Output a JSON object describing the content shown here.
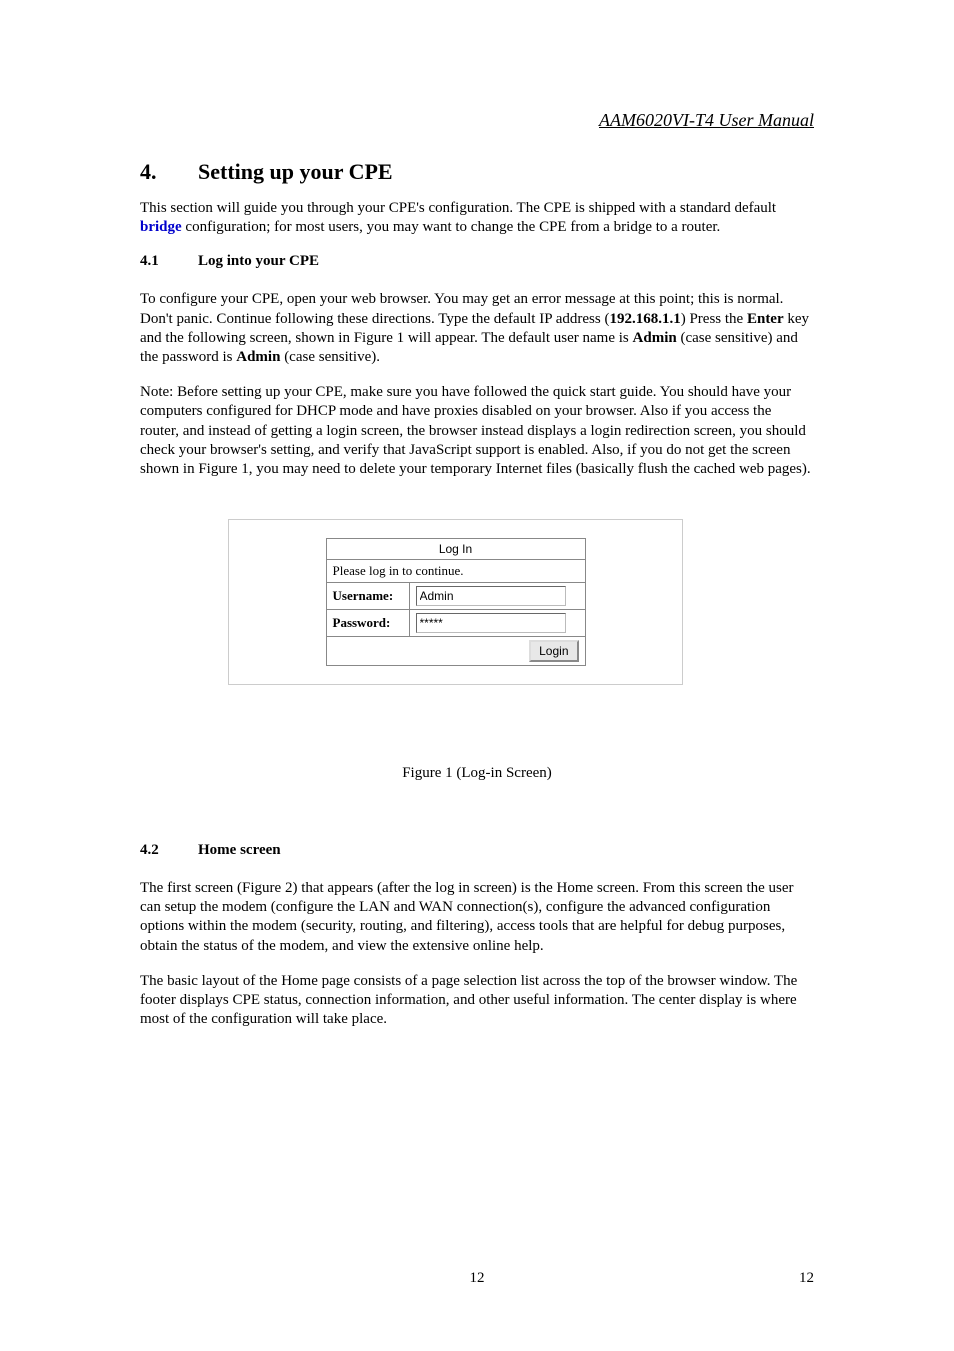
{
  "header": {
    "doc_title": "AAM6020VI-T4 User Manual"
  },
  "section": {
    "num": "4.",
    "title": "Setting up your CPE",
    "intro_1": "This section will guide you through your CPE's configuration.   The CPE is shipped with a standard default ",
    "intro_blue": "bridge",
    "intro_2": " configuration; for most users, you may want to change the CPE from a bridge to a router."
  },
  "sub41": {
    "num": "4.1",
    "title": "Log into your CPE",
    "p1_a": "To configure your CPE, open your web browser.  You may get an error message at this point; this is normal.  Don't panic.  Continue following these directions. Type the default IP address (",
    "p1_ip": "192.168.1.1",
    "p1_b": ") Press the ",
    "p1_enter": "Enter",
    "p1_c": " key and the following screen, shown in Figure 1 will appear. The default user name is ",
    "p1_admin1": "Admin",
    "p1_d": " (case sensitive) and the password is ",
    "p1_admin2": "Admin",
    "p1_e": "  (case sensitive).",
    "p2": "Note: Before setting up your CPE, make sure you have followed the quick start guide.  You should have your computers configured for DHCP mode and have proxies disabled on your browser.  Also if you access the router, and instead of getting a login screen, the browser instead displays a login redirection screen, you should check your browser's setting, and verify that JavaScript support is enabled.  Also, if you do not get the screen shown in Figure 1, you may need to delete your temporary Internet files (basically flush the cached web pages)."
  },
  "login": {
    "box_title": "Log In",
    "message": "Please log in to continue.",
    "user_label": "Username:",
    "user_value": "Admin",
    "pass_label": "Password:",
    "pass_value": "*****",
    "button": "Login"
  },
  "figure1_caption": "Figure 1 (Log-in Screen)",
  "sub42": {
    "num": "4.2",
    "title": "Home screen",
    "p1": "The first screen (Figure 2) that appears (after the log in screen) is the Home screen.  From this screen the user can setup the modem (configure the LAN and WAN connection(s), configure the advanced configuration options within the modem (security, routing, and filtering), access tools that are helpful for debug purposes, obtain the status of the modem, and view the extensive online help.",
    "p2": "The basic layout of the Home page consists of a page selection list across the top of the browser window.  The footer displays CPE status, connection information, and other useful information. The center display is where most of the configuration will take place."
  },
  "page_number": "12"
}
